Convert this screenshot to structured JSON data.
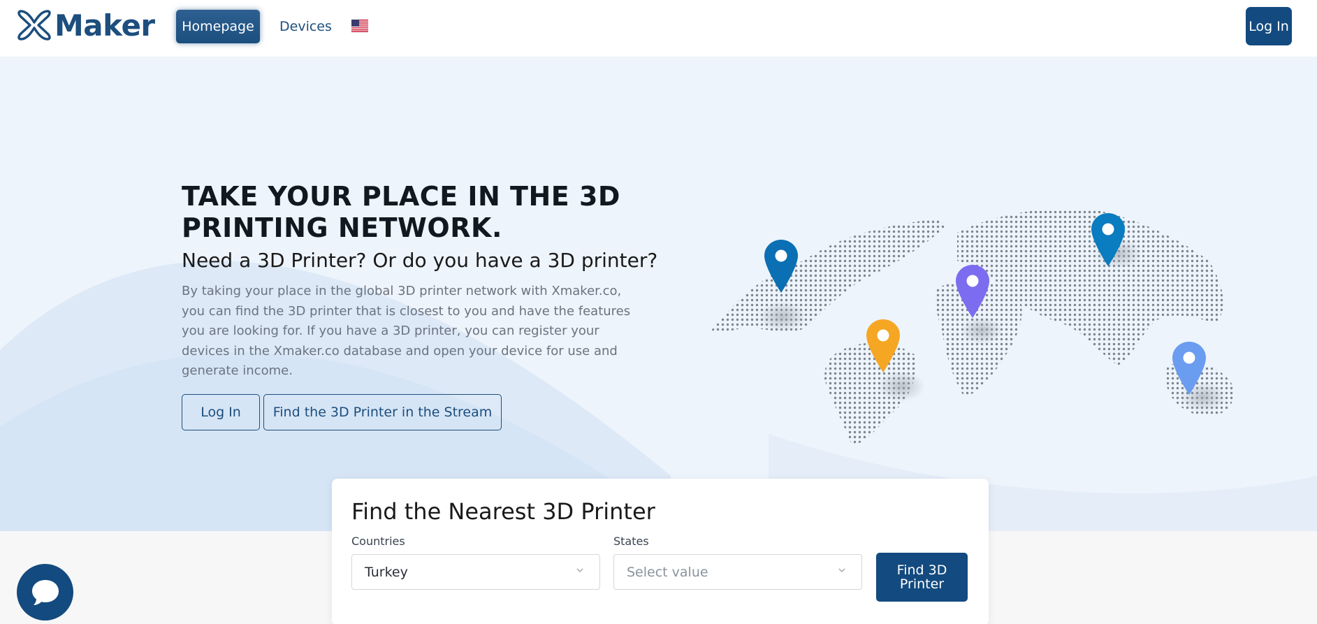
{
  "header": {
    "logo_text": "Maker",
    "nav": [
      {
        "label": "Homepage",
        "active": true
      },
      {
        "label": "Devices",
        "active": false
      }
    ],
    "language_flag": "us-flag-icon",
    "login_label": "Log In"
  },
  "hero": {
    "title": "TAKE YOUR PLACE IN THE 3D PRINTING NETWORK.",
    "subtitle": "Need a 3D Printer? Or do you have a 3D printer?",
    "description": "By taking your place in the global 3D printer network with Xmaker.co, you can find the 3D printer that is closest to you and have the features you are looking for. If you have a 3D printer, you can register your devices in the Xmaker.co database and open your device for use and generate income.",
    "login_button": "Log In",
    "stream_button": "Find the 3D Printer in the Stream",
    "map_pins": [
      "#0a6fb3",
      "#f5a623",
      "#7b6cf0",
      "#0a7cc0",
      "#6a9cf0"
    ]
  },
  "search": {
    "title": "Find the Nearest 3D Printer",
    "countries_label": "Countries",
    "countries_value": "Turkey",
    "states_label": "States",
    "states_placeholder": "Select value",
    "find_button": "Find 3D Printer"
  },
  "colors": {
    "brand": "#1c4e7e",
    "hero_bg": "#eef4fb",
    "button_dark": "#134a7f"
  }
}
